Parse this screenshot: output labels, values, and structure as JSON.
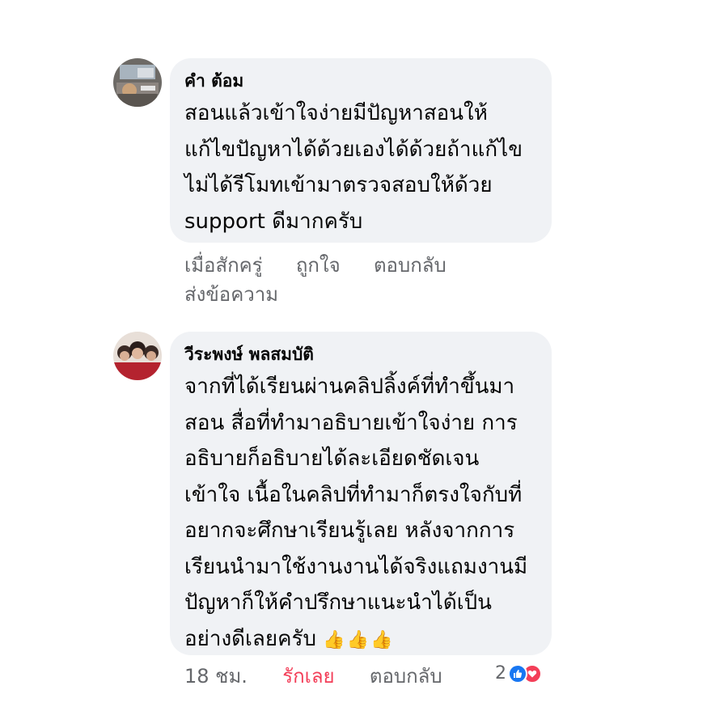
{
  "comments": [
    {
      "author": "คำ ต้อม",
      "text": "สอนแล้วเข้าใจง่ายมีปัญหาสอนให้\nแก้ไขปัญหาได้ด้วยเองได้ด้วยถ้าแก้ไข\nไม่ได้รีโมทเข้ามาตรวจสอบให้ด้วย\nsupport ดีมากครับ",
      "time": "เมื่อสักครู่",
      "like_label": "ถูกใจ",
      "reply_label": "ตอบกลับ",
      "send_label": "ส่งข้อความ"
    },
    {
      "author": "วีระพงษ์ พลสมบัติ",
      "text": "จากที่ได้เรียนผ่านคลิปลิ้งค์ที่ทำขึ้นมา\nสอน สื่อที่ทำมาอธิบายเข้าใจง่าย การ\nอธิบายก็อธิบายได้ละเอียดชัดเจน\nเข้าใจ เนื้อในคลิปที่ทำมาก็ตรงใจกับที่\nอยากจะศึกษาเรียนรู้เลย หลังจากการ\nเรียนนำมาใช้งานงานได้จริงแถมงานมี\nปัญหาก็ให้คำปรึกษาแนะนำได้เป็น\nอย่างดีเลยครับ",
      "emoji": "👍👍👍",
      "time": "18 ชม.",
      "love_label": "รักเลย",
      "reply_label": "ตอบกลับ",
      "reaction_count": "2"
    }
  ],
  "icons": {
    "like_reaction": "thumbs-up-icon",
    "love_reaction": "heart-icon"
  },
  "colors": {
    "bubble": "#f0f2f5",
    "love_text": "#f33e58",
    "like_blue": "#1877f2",
    "meta_gray": "#65676b"
  }
}
